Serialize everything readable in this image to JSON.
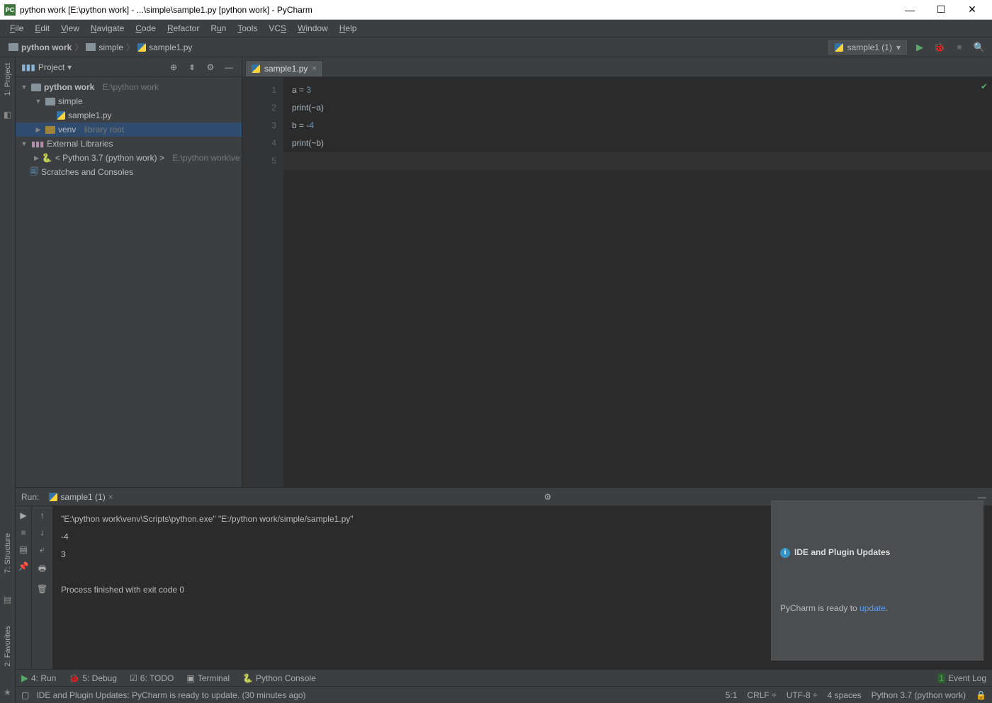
{
  "window": {
    "title": "python work [E:\\python work] - ...\\simple\\sample1.py [python work] - PyCharm"
  },
  "menu": [
    "File",
    "Edit",
    "View",
    "Navigate",
    "Code",
    "Refactor",
    "Run",
    "Tools",
    "VCS",
    "Window",
    "Help"
  ],
  "breadcrumb": {
    "root": "python work",
    "folder": "simple",
    "file": "sample1.py"
  },
  "run_config": {
    "name": "sample1 (1)"
  },
  "sidebar": {
    "title": "Project",
    "tree": {
      "project": {
        "name": "python work",
        "path": "E:\\python work"
      },
      "folder1": "simple",
      "file1": "sample1.py",
      "venv": {
        "name": "venv",
        "note": "library root"
      },
      "ext": "External Libraries",
      "py": {
        "label": "< Python 3.7 (python work) >",
        "path": "E:\\python work\\ve"
      },
      "scratch": "Scratches and Consoles"
    }
  },
  "left_tool": {
    "project": "1: Project"
  },
  "left_tool2": {
    "structure": "7: Structure",
    "favorites": "2: Favorites"
  },
  "editor": {
    "tab": "sample1.py",
    "lines": [
      "1",
      "2",
      "3",
      "4",
      "5"
    ],
    "code": {
      "l1a": "a = ",
      "l1b": "3",
      "l2a": "print",
      "l2b": "(~a)",
      "l3a": "b = -",
      "l3b": "4",
      "l4a": "print",
      "l4b": "(~b)"
    }
  },
  "run": {
    "title": "Run:",
    "tab": "sample1 (1)",
    "output_cmd": "\"E:\\python work\\venv\\Scripts\\python.exe\" \"E:/python work/simple/sample1.py\"",
    "out1": "-4",
    "out2": "3",
    "finished": "Process finished with exit code 0"
  },
  "notif": {
    "title": "IDE and Plugin Updates",
    "body_a": "PyCharm is ready to ",
    "body_link": "update",
    "body_b": "."
  },
  "toolwindows": {
    "run": "4: Run",
    "debug": "5: Debug",
    "todo": "6: TODO",
    "terminal": "Terminal",
    "pyconsole": "Python Console",
    "eventlog": "Event Log"
  },
  "status": {
    "msg": "IDE and Plugin Updates: PyCharm is ready to update. (30 minutes ago)",
    "pos": "5:1",
    "eol": "CRLF",
    "enc": "UTF-8",
    "indent": "4 spaces",
    "tail": " Python 3.7 (python work) "
  }
}
